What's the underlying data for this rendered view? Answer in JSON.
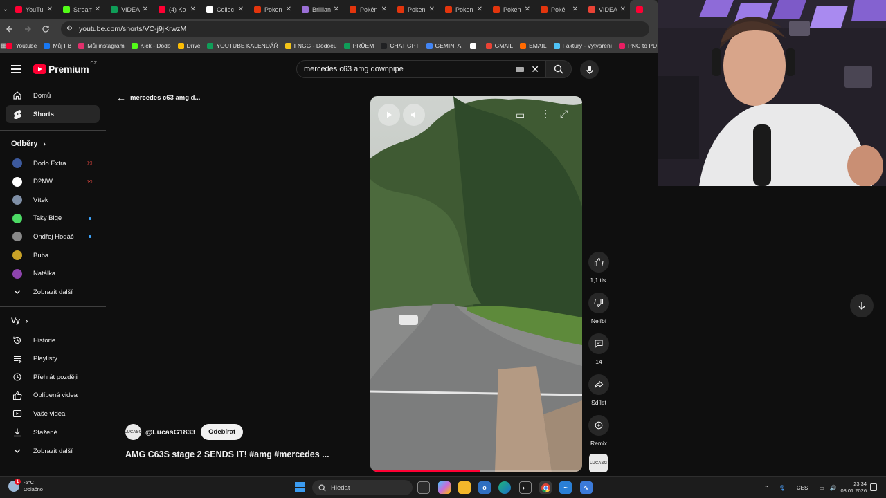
{
  "browser": {
    "tabs": [
      {
        "title": "YouTu",
        "icon": "youtube-icon",
        "color": "#ff0033",
        "active": false
      },
      {
        "title": "Stream",
        "icon": "kick-icon",
        "color": "#53fc18",
        "active": false
      },
      {
        "title": "VIDEA",
        "icon": "sheets-icon",
        "color": "#0f9d58",
        "active": false
      },
      {
        "title": "(4) Ko",
        "icon": "youtube-icon",
        "color": "#ff0033",
        "active": false
      },
      {
        "title": "Collec",
        "icon": "collection-icon",
        "color": "#ffffff",
        "active": false
      },
      {
        "title": "Poken",
        "icon": "pokemon-icon",
        "color": "#e3350d",
        "active": false
      },
      {
        "title": "Brillian",
        "icon": "bulbapedia-icon",
        "color": "#9a6fd6",
        "active": false
      },
      {
        "title": "Pokén",
        "icon": "pokemon-icon",
        "color": "#e3350d",
        "active": false
      },
      {
        "title": "Poken",
        "icon": "pokemon-icon",
        "color": "#e3350d",
        "active": false
      },
      {
        "title": "Poken",
        "icon": "pokemon-icon",
        "color": "#e3350d",
        "active": false
      },
      {
        "title": "Pokén",
        "icon": "pokemon-icon",
        "color": "#e3350d",
        "active": false
      },
      {
        "title": "Poké",
        "icon": "pokemon-icon",
        "color": "#e3350d",
        "active": false
      },
      {
        "title": "VIDEA",
        "icon": "gmail-icon",
        "color": "#ea4335",
        "active": false
      },
      {
        "title": "",
        "icon": "youtube-icon",
        "color": "#ff0033",
        "active": true
      }
    ],
    "url": "youtube.com/shorts/VC-j9jKrwzM",
    "bookmarks": [
      {
        "label": "Youtube",
        "icon": "youtube-icon",
        "color": "#ff0033"
      },
      {
        "label": "Můj FB",
        "icon": "facebook-icon",
        "color": "#1877f2"
      },
      {
        "label": "Můj instagram",
        "icon": "instagram-icon",
        "color": "#e1306c"
      },
      {
        "label": "Kick - Dodo",
        "icon": "kick-icon",
        "color": "#53fc18"
      },
      {
        "label": "Drive",
        "icon": "drive-icon",
        "color": "#fbbc04"
      },
      {
        "label": "YOUTUBE KALENDÁŘ",
        "icon": "sheets-icon",
        "color": "#0f9d58"
      },
      {
        "label": "FNGG - Dodoeu",
        "icon": "fngg-icon",
        "color": "#f5c518"
      },
      {
        "label": "PRŮEM",
        "icon": "sheets-icon",
        "color": "#0f9d58"
      },
      {
        "label": "CHAT GPT",
        "icon": "chatgpt-icon",
        "color": "#202123"
      },
      {
        "label": "GEMINI AI",
        "icon": "gemini-icon",
        "color": "#4285f4"
      },
      {
        "label": "",
        "icon": "notion-icon",
        "color": "#ffffff"
      },
      {
        "label": "GMAIL",
        "icon": "gmail-icon",
        "color": "#ea4335"
      },
      {
        "label": "EMAIL",
        "icon": "email-icon",
        "color": "#ff6a00"
      },
      {
        "label": "Faktury - Vytváření",
        "icon": "invoice-icon",
        "color": "#4fc3f7"
      },
      {
        "label": "PNG to PD",
        "icon": "png-icon",
        "color": "#e91e63"
      }
    ]
  },
  "youtube": {
    "logo_text": "Premium",
    "country_code": "CZ",
    "search_query": "mercedes c63 amg downpipe",
    "sidebar": {
      "main": [
        {
          "label": "Domů",
          "icon": "home-icon",
          "active": false
        },
        {
          "label": "Shorts",
          "icon": "shorts-icon",
          "active": true
        }
      ],
      "subs_header": "Odběry",
      "subs": [
        {
          "label": "Dodo Extra",
          "color": "#3d5a9e",
          "badge": "live"
        },
        {
          "label": "D2NW",
          "color": "#ffffff",
          "badge": "live"
        },
        {
          "label": "Vítek",
          "color": "#7f8fa6",
          "badge": ""
        },
        {
          "label": "Taky Bige",
          "color": "#4cd964",
          "badge": "dot"
        },
        {
          "label": "Ondřej Hodáč",
          "color": "#888888",
          "badge": "dot"
        },
        {
          "label": "Buba",
          "color": "#c9a227",
          "badge": ""
        },
        {
          "label": "Natálka",
          "color": "#8e44ad",
          "badge": ""
        }
      ],
      "subs_more": "Zobrazit další",
      "you_header": "Vy",
      "you": [
        {
          "label": "Historie",
          "icon": "history-icon"
        },
        {
          "label": "Playlisty",
          "icon": "playlist-icon"
        },
        {
          "label": "Přehrát později",
          "icon": "clock-icon"
        },
        {
          "label": "Oblíbená videa",
          "icon": "thumbs-up-icon"
        },
        {
          "label": "Vaše videa",
          "icon": "video-icon"
        },
        {
          "label": "Stažené",
          "icon": "download-icon"
        }
      ],
      "you_more": "Zobrazit další"
    },
    "back_label": "mercedes c63 amg d...",
    "short": {
      "channel": "@LucasG1833",
      "channel_avatar_text": "LUCASG",
      "subscribe_label": "Odebírat",
      "title": "AMG C63S stage 2 SENDS IT! #amg #mercedes ...",
      "progress": 0.52,
      "actions": [
        {
          "label": "1,1 tis.",
          "icon": "thumbs-up-icon"
        },
        {
          "label": "Nelíbí",
          "icon": "thumbs-down-icon"
        },
        {
          "label": "14",
          "icon": "comment-icon"
        },
        {
          "label": "Sdílet",
          "icon": "share-icon"
        },
        {
          "label": "Remix",
          "icon": "remix-icon"
        }
      ]
    }
  },
  "taskbar": {
    "weather_temp": "-5°C",
    "weather_desc": "Oblačno",
    "weather_badge": "1",
    "search_placeholder": "Hledat",
    "language": "CES",
    "time": "23:34",
    "date": "08.01.2026"
  }
}
